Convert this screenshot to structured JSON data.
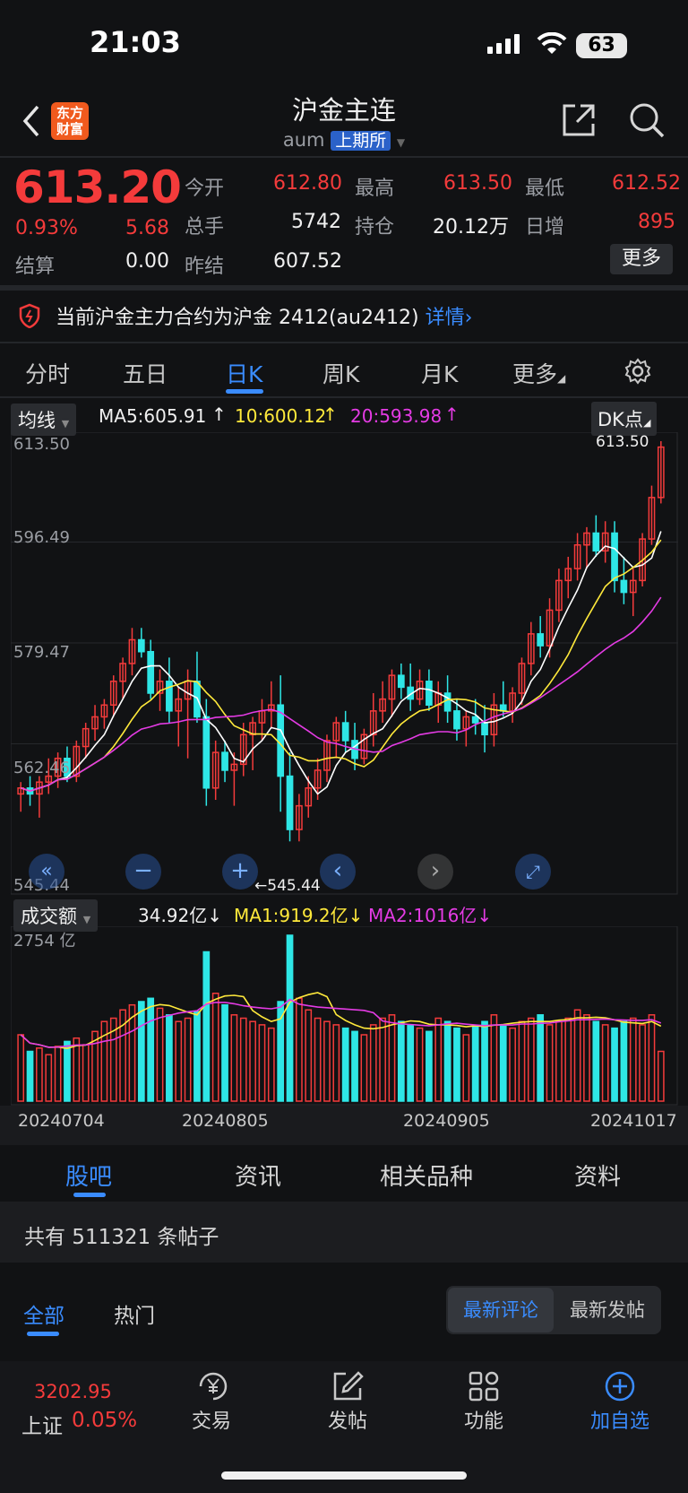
{
  "status_bar": {
    "time": "21:03",
    "battery": "63"
  },
  "header": {
    "title": "沪金主连",
    "code": "aum",
    "exchange": "上期所",
    "logo_line1": "东方",
    "logo_line2": "财富"
  },
  "quote": {
    "price": "613.20",
    "change_pct": "0.93%",
    "change": "5.68",
    "settle_label": "结算",
    "settle": "0.00",
    "open_label": "今开",
    "open": "612.80",
    "volume_label": "总手",
    "volume": "5742",
    "prev_settle_label": "昨结",
    "prev_settle": "607.52",
    "high_label": "最高",
    "high": "613.50",
    "oi_label": "持仓",
    "oi": "20.12万",
    "low_label": "最低",
    "low": "612.52",
    "daily_inc_label": "日增",
    "daily_inc": "895",
    "more_label": "更多"
  },
  "notice": {
    "text": "当前沪金主力合约为沪金 2412(au2412)",
    "link": "详情"
  },
  "chart_tabs": [
    "分时",
    "五日",
    "日K",
    "周K",
    "月K",
    "更多"
  ],
  "indicator": {
    "selector": "均线",
    "ma5": "MA5:605.91",
    "ma10": "10:600.12",
    "ma20": "20:593.98",
    "dk_button": "DK点",
    "price_axis": [
      "613.50",
      "596.49",
      "579.47",
      "562.46",
      "545.44"
    ],
    "high_marker": "613.50",
    "low_marker": "545.44"
  },
  "volume_panel": {
    "selector": "成交额",
    "value": "34.92亿",
    "ma1": "MA1:919.2亿",
    "ma2": "MA2:1016亿",
    "axis_top": "2754 亿",
    "dates": [
      "20240704",
      "20240805",
      "20240905",
      "20241017"
    ]
  },
  "colors": {
    "up": "#f43b3b",
    "down": "#2ee6e6",
    "ma5": "#ffffff",
    "ma10": "#ffe93b",
    "ma20": "#e43be4",
    "accent": "#3a8cff"
  },
  "chart_data": {
    "type": "candlestick",
    "ylim": [
      545.44,
      613.5
    ],
    "candles": [
      [
        554,
        556,
        551,
        555
      ],
      [
        555,
        557,
        552,
        554
      ],
      [
        554,
        557,
        550,
        556
      ],
      [
        556,
        560,
        554,
        557
      ],
      [
        557,
        561,
        555,
        560
      ],
      [
        560,
        562,
        556,
        557
      ],
      [
        557,
        563,
        556,
        562
      ],
      [
        562,
        566,
        560,
        565
      ],
      [
        565,
        569,
        563,
        567
      ],
      [
        567,
        570,
        565,
        569
      ],
      [
        569,
        574,
        567,
        573
      ],
      [
        573,
        577,
        570,
        576
      ],
      [
        576,
        582,
        574,
        580
      ],
      [
        580,
        582,
        577,
        578
      ],
      [
        578,
        580,
        570,
        571
      ],
      [
        571,
        575,
        568,
        573
      ],
      [
        573,
        577,
        566,
        568
      ],
      [
        568,
        572,
        562,
        570
      ],
      [
        570,
        575,
        560,
        573
      ],
      [
        573,
        578,
        566,
        567
      ],
      [
        567,
        570,
        552,
        555
      ],
      [
        555,
        563,
        553,
        561
      ],
      [
        561,
        563,
        556,
        558
      ],
      [
        558,
        561,
        552,
        559
      ],
      [
        559,
        566,
        557,
        564
      ],
      [
        564,
        567,
        558,
        566
      ],
      [
        566,
        570,
        563,
        568
      ],
      [
        568,
        573,
        565,
        569
      ],
      [
        569,
        574,
        551,
        557
      ],
      [
        557,
        561,
        546,
        548
      ],
      [
        548,
        554,
        546,
        552
      ],
      [
        552,
        557,
        550,
        555
      ],
      [
        555,
        560,
        553,
        558
      ],
      [
        558,
        564,
        556,
        563
      ],
      [
        563,
        567,
        560,
        566
      ],
      [
        566,
        568,
        561,
        563
      ],
      [
        563,
        566,
        558,
        560
      ],
      [
        560,
        565,
        559,
        564
      ],
      [
        564,
        571,
        562,
        568
      ],
      [
        568,
        573,
        566,
        570
      ],
      [
        570,
        575,
        567,
        574
      ],
      [
        574,
        576,
        570,
        572
      ],
      [
        572,
        576,
        568,
        570
      ],
      [
        570,
        575,
        569,
        573
      ],
      [
        573,
        575,
        568,
        569
      ],
      [
        569,
        573,
        566,
        571
      ],
      [
        571,
        574,
        566,
        568
      ],
      [
        568,
        570,
        563,
        565
      ],
      [
        565,
        568,
        562,
        567
      ],
      [
        567,
        570,
        564,
        566
      ],
      [
        566,
        569,
        561,
        564
      ],
      [
        564,
        571,
        562,
        569
      ],
      [
        569,
        573,
        567,
        568
      ],
      [
        568,
        572,
        566,
        571
      ],
      [
        571,
        577,
        569,
        576
      ],
      [
        576,
        583,
        574,
        581
      ],
      [
        581,
        584,
        577,
        579
      ],
      [
        579,
        587,
        577,
        585
      ],
      [
        585,
        592,
        583,
        590
      ],
      [
        590,
        594,
        587,
        592
      ],
      [
        592,
        598,
        590,
        596
      ],
      [
        596,
        599,
        592,
        598
      ],
      [
        598,
        601,
        594,
        595
      ],
      [
        595,
        600,
        593,
        598
      ],
      [
        598,
        600,
        588,
        590
      ],
      [
        590,
        594,
        586,
        588
      ],
      [
        588,
        592,
        584,
        590
      ],
      [
        590,
        598,
        589,
        597
      ],
      [
        597,
        606,
        596,
        604
      ],
      [
        604,
        613.5,
        603,
        612.5
      ]
    ],
    "volume": [
      40,
      30,
      32,
      28,
      33,
      36,
      38,
      34,
      42,
      48,
      50,
      55,
      58,
      60,
      62,
      56,
      52,
      48,
      50,
      54,
      90,
      65,
      58,
      52,
      50,
      48,
      46,
      44,
      60,
      100,
      62,
      55,
      50,
      48,
      46,
      44,
      42,
      40,
      46,
      50,
      52,
      48,
      46,
      44,
      42,
      50,
      48,
      44,
      40,
      45,
      48,
      52,
      46,
      44,
      48,
      50,
      52,
      46,
      48,
      50,
      55,
      52,
      48,
      46,
      44,
      48,
      50,
      46,
      52,
      30
    ]
  },
  "bottom_tabs": [
    "股吧",
    "资讯",
    "相关品种",
    "资料"
  ],
  "posts": {
    "count_text": "共有 511321 条帖子"
  },
  "filters": {
    "all": "全部",
    "hot": "热门",
    "latest_comment": "最新评论",
    "latest_post": "最新发帖"
  },
  "bottom_nav": {
    "index_value": "3202.95",
    "index_name": "上证",
    "index_change": "0.05%",
    "trade": "交易",
    "post": "发帖",
    "features": "功能",
    "add_watch": "加自选"
  }
}
